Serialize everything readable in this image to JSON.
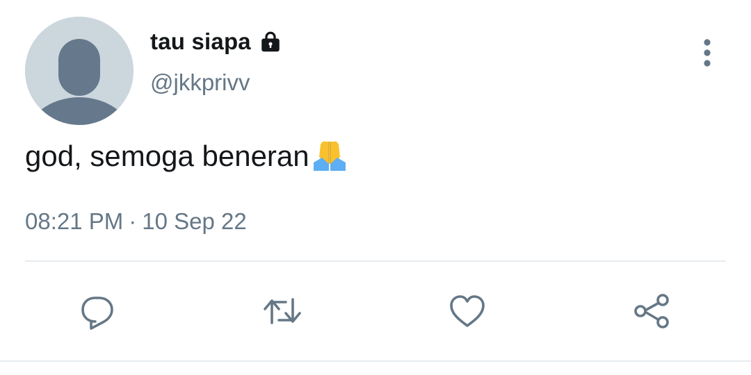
{
  "tweet": {
    "display_name": "tau siapa",
    "handle": "@jkkprivv",
    "text": "god, semoga beneran",
    "emoji": "folded-hands",
    "time": "08:21 PM",
    "separator": "·",
    "date": "10 Sep 22",
    "protected_icon": "lock-icon"
  },
  "icons": {
    "more": "more-vertical-icon",
    "reply": "reply-icon",
    "retweet": "retweet-icon",
    "like": "heart-icon",
    "share": "share-icon"
  },
  "colors": {
    "text_primary": "#14171a",
    "text_secondary": "#657786",
    "icon": "#657786",
    "divider": "#e6ecf0",
    "avatar_bg": "#ccd6dd",
    "avatar_fg": "#66798c"
  }
}
